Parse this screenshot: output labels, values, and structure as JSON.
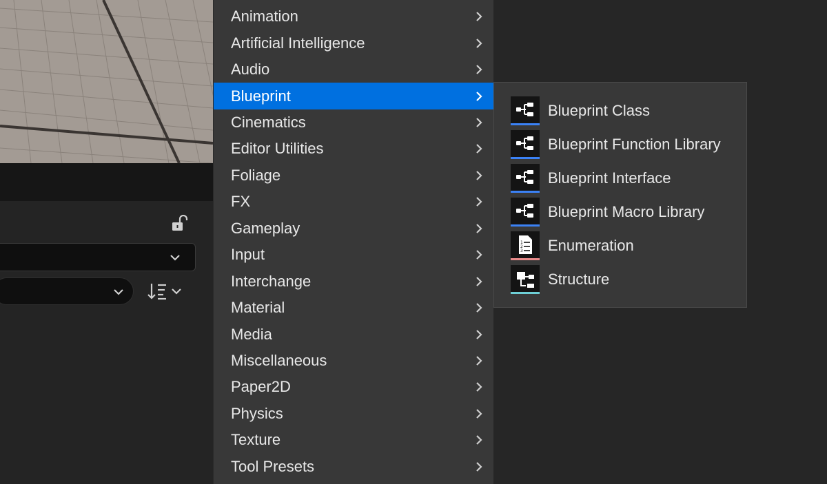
{
  "menu": {
    "items": [
      {
        "label": "Animation",
        "active": false
      },
      {
        "label": "Artificial Intelligence",
        "active": false
      },
      {
        "label": "Audio",
        "active": false
      },
      {
        "label": "Blueprint",
        "active": true
      },
      {
        "label": "Cinematics",
        "active": false
      },
      {
        "label": "Editor Utilities",
        "active": false
      },
      {
        "label": "Foliage",
        "active": false
      },
      {
        "label": "FX",
        "active": false
      },
      {
        "label": "Gameplay",
        "active": false
      },
      {
        "label": "Input",
        "active": false
      },
      {
        "label": "Interchange",
        "active": false
      },
      {
        "label": "Material",
        "active": false
      },
      {
        "label": "Media",
        "active": false
      },
      {
        "label": "Miscellaneous",
        "active": false
      },
      {
        "label": "Paper2D",
        "active": false
      },
      {
        "label": "Physics",
        "active": false
      },
      {
        "label": "Texture",
        "active": false
      },
      {
        "label": "Tool Presets",
        "active": false
      }
    ],
    "highlight_color": "#0070e0"
  },
  "submenu": {
    "items": [
      {
        "label": "Blueprint Class",
        "icon": "blueprint-graph-icon",
        "accent": "#3b82f6"
      },
      {
        "label": "Blueprint Function Library",
        "icon": "blueprint-graph-icon",
        "accent": "#3b82f6"
      },
      {
        "label": "Blueprint Interface",
        "icon": "blueprint-graph-icon",
        "accent": "#3b82f6"
      },
      {
        "label": "Blueprint Macro Library",
        "icon": "blueprint-graph-icon",
        "accent": "#3b82f6"
      },
      {
        "label": "Enumeration",
        "icon": "enumeration-list-icon",
        "accent": "#e88a8a"
      },
      {
        "label": "Structure",
        "icon": "structure-icon",
        "accent": "#6ecfd6"
      }
    ]
  },
  "details": {
    "lock_icon": "unlocked-padlock-icon",
    "sort_icon": "sort-descending-icon"
  }
}
